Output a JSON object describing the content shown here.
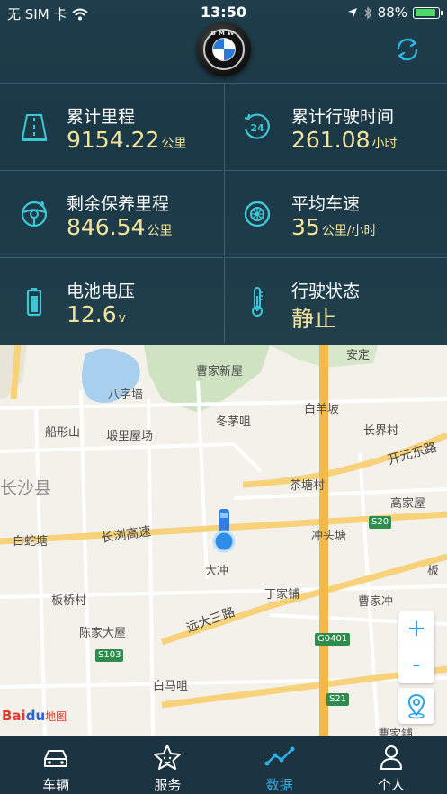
{
  "status_bar": {
    "carrier": "无 SIM 卡",
    "time": "13:50",
    "battery": "88%"
  },
  "header": {
    "logo_letters": "BMW",
    "refresh_icon": "refresh-icon"
  },
  "stats": [
    {
      "title": "累计里程",
      "value": "9154.22",
      "unit": "公里",
      "icon": "road-icon"
    },
    {
      "title": "累计行驶时间",
      "value": "261.08",
      "unit": "小时",
      "icon": "24h-clock-icon"
    },
    {
      "title": "剩余保养里程",
      "value": "846.54",
      "unit": "公里",
      "icon": "steering-wheel-icon"
    },
    {
      "title": "平均车速",
      "value": "35",
      "unit": "公里/小时",
      "icon": "wheel-icon"
    },
    {
      "title": "电池电压",
      "value": "12.6",
      "unit": "v",
      "icon": "battery-icon"
    },
    {
      "title": "行驶状态",
      "value": "静止",
      "unit": "",
      "icon": "thermometer-icon"
    }
  ],
  "map": {
    "labels": {
      "an_ding": "安定",
      "cao_jia_xin_wu": "曹家新屋",
      "ba_zi_qiang": "八字墙",
      "dong_mao_ju": "冬茅咀",
      "bai_yang_po": "白羊坡",
      "chuan_xing_shan": "船形山",
      "duan_li_wu_chang": "塅里屋场",
      "chang_jie_cun": "长界村",
      "kai_yuan_dong_lu": "开元东路",
      "chang_sha_xian": "长沙县",
      "cha_tang_cun": "茶塘村",
      "gao_jia_wu": "高家屋",
      "bai_she_tang": "白蛇塘",
      "chang_liu_gao_su": "长浏高速",
      "chong_tou_tang": "冲头塘",
      "ban": "板",
      "da_chong": "大冲",
      "ban_qiao_cun": "板桥村",
      "ding_jia_pu": "丁家铺",
      "cao_jia_chong": "曹家冲",
      "yuan_da_san_lu": "远大三路",
      "chen_jia_da_wu": "陈家大屋",
      "bai_ma_ju": "白马咀",
      "cao_jia_pu": "曹家铺"
    },
    "shields": {
      "s20": "S20",
      "g0401": "G0401",
      "s103": "S103",
      "s21": "S21"
    },
    "zoom_in": "+",
    "zoom_out": "-",
    "brand": {
      "bai": "Bai",
      "du": "du",
      "map_word": "地图"
    }
  },
  "tabs": [
    {
      "label": "车辆",
      "icon": "car-icon",
      "active": false
    },
    {
      "label": "服务",
      "icon": "star-icon",
      "active": false
    },
    {
      "label": "数据",
      "icon": "chart-line-icon",
      "active": true
    },
    {
      "label": "个人",
      "icon": "person-icon",
      "active": false
    }
  ],
  "colors": {
    "accent": "#2fb3e6",
    "value": "#f3e39a",
    "background": "#1d3a47"
  }
}
